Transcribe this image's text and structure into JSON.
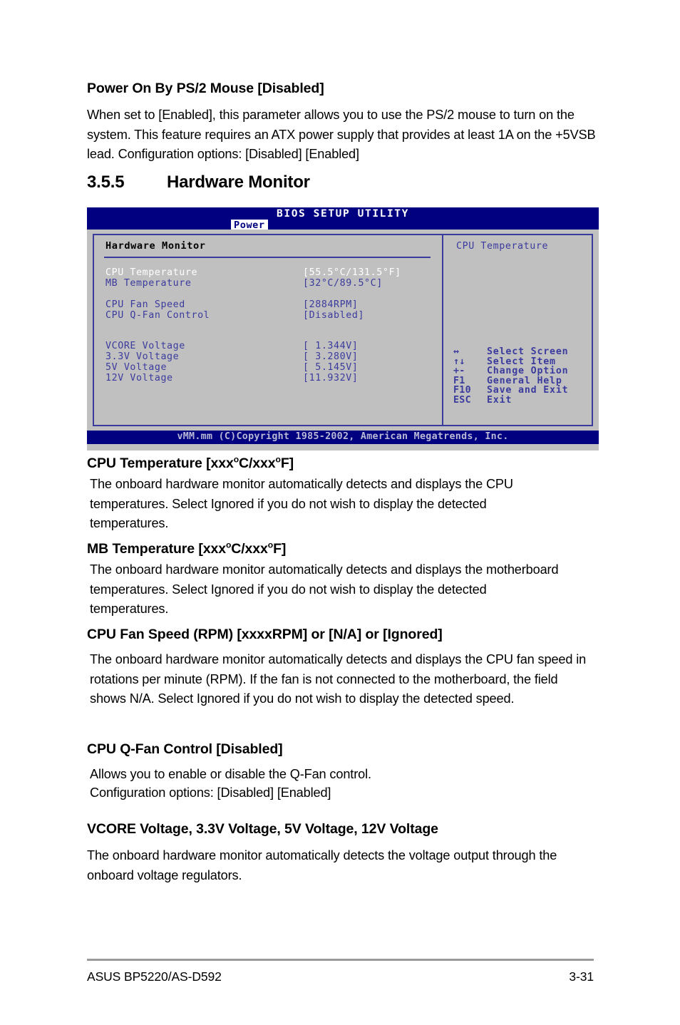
{
  "document": {
    "sections": [
      {
        "id": "power-on-ps2",
        "heading": "Power On By PS/2 Mouse [Disabled]",
        "body": "When set to [Enabled], this parameter allows you to use the PS/2 mouse to turn on the system. This feature requires an ATX power supply that provides at least 1A on the +5VSB lead. Configuration options: [Disabled] [Enabled]"
      }
    ],
    "section_heading": {
      "number": "3.5.5",
      "title": "Hardware Monitor"
    },
    "cpu_temperature": {
      "heading_pre": "CPU Temperature [xxx",
      "heading_mid": "C/xxx",
      "heading_post": "F]",
      "body": "The onboard hardware monitor automatically detects and displays the CPU temperatures. Select Ignored if you do not wish to display the detected temperatures."
    },
    "mb_temperature": {
      "heading_pre": "MB Temperature [xxx",
      "heading_mid": "C/xxx",
      "heading_post": "F]",
      "body": "The onboard hardware monitor automatically detects and displays the motherboard temperatures. Select Ignored if you do not wish to display the detected temperatures."
    },
    "cpu_fan_speed": {
      "heading": "CPU Fan Speed (RPM) [xxxxRPM] or [N/A] or [Ignored]",
      "body": "The onboard hardware monitor automatically detects and displays the CPU fan speed in rotations per minute (RPM). If the fan is not connected to the motherboard, the field shows N/A. Select Ignored if you do not wish to display the detected speed."
    },
    "cpu_qfan_control": {
      "heading": "CPU Q-Fan Control [Disabled]",
      "body_line1": "Allows you to enable or disable the Q-Fan control.",
      "body_line2": "Configuration options: [Disabled] [Enabled]"
    },
    "voltages": {
      "heading": "VCORE Voltage, 3.3V Voltage, 5V Voltage, 12V Voltage",
      "body": "The onboard hardware monitor automatically detects the voltage output through the onboard voltage regulators."
    },
    "footer": {
      "left": "ASUS BP5220/AS-D592",
      "page": "3-31"
    }
  },
  "bios": {
    "title": "BIOS SETUP UTILITY",
    "active_tab": "Power",
    "panel_title": "Hardware Monitor",
    "items": [
      {
        "label": "CPU Temperature",
        "value": "[55.5°C/131.5°F]",
        "selected": true
      },
      {
        "label": "MB Temperature",
        "value": "[32°C/89.5°C]",
        "selected": false
      },
      {
        "label": "CPU Fan Speed",
        "value": "[2884RPM]",
        "selected": false
      },
      {
        "label": "CPU Q-Fan Control",
        "value": "[Disabled]",
        "selected": false
      },
      {
        "label": "VCORE Voltage",
        "value": "[ 1.344V]",
        "selected": false
      },
      {
        "label": "3.3V Voltage",
        "value": "[ 3.280V]",
        "selected": false
      },
      {
        "label": "5V Voltage",
        "value": "[ 5.145V]",
        "selected": false
      },
      {
        "label": "12V Voltage",
        "value": "[11.932V]",
        "selected": false
      }
    ],
    "help": {
      "title": "CPU Temperature"
    },
    "keys": [
      {
        "key": "↔",
        "desc": "Select Screen"
      },
      {
        "key": "↑↓",
        "desc": "Select Item"
      },
      {
        "key": "+-",
        "desc": "Change Option"
      },
      {
        "key": "F1",
        "desc": "General Help"
      },
      {
        "key": "F10",
        "desc": "Save and Exit"
      },
      {
        "key": "ESC",
        "desc": "Exit"
      }
    ],
    "copyright": "vMM.mm (C)Copyright 1985-2002, American Megatrends, Inc.",
    "colors": {
      "chrome_blue": "#000080",
      "text_blue": "#3b3b9e",
      "panel_gray": "#c0c0c0",
      "selected_white": "#ffffff"
    }
  }
}
